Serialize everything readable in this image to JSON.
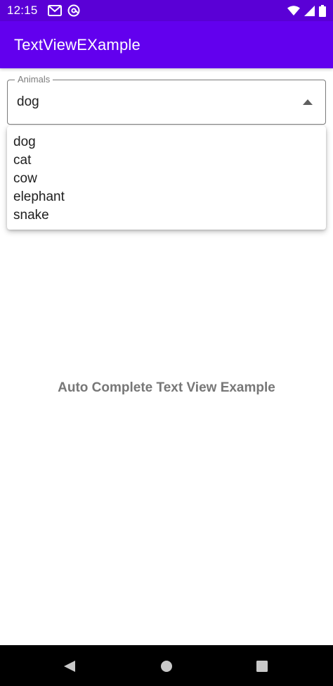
{
  "status_bar": {
    "time": "12:15",
    "left_icons": [
      "gmail-icon",
      "at-sign-icon"
    ],
    "right_icons": [
      "wifi-icon",
      "cellular-signal-icon",
      "battery-icon"
    ],
    "background_color": "#5a00d6"
  },
  "app_bar": {
    "title": "TextViewEXample",
    "background_color": "#6200ee"
  },
  "field": {
    "label": "Animals",
    "value": "dog"
  },
  "dropdown": {
    "items": [
      "dog",
      "cat",
      "cow",
      "elephant",
      "snake"
    ]
  },
  "main": {
    "caption": "Auto Complete Text View Example"
  },
  "nav_bar": {
    "buttons": [
      "back-icon",
      "home-icon",
      "recents-icon"
    ]
  }
}
